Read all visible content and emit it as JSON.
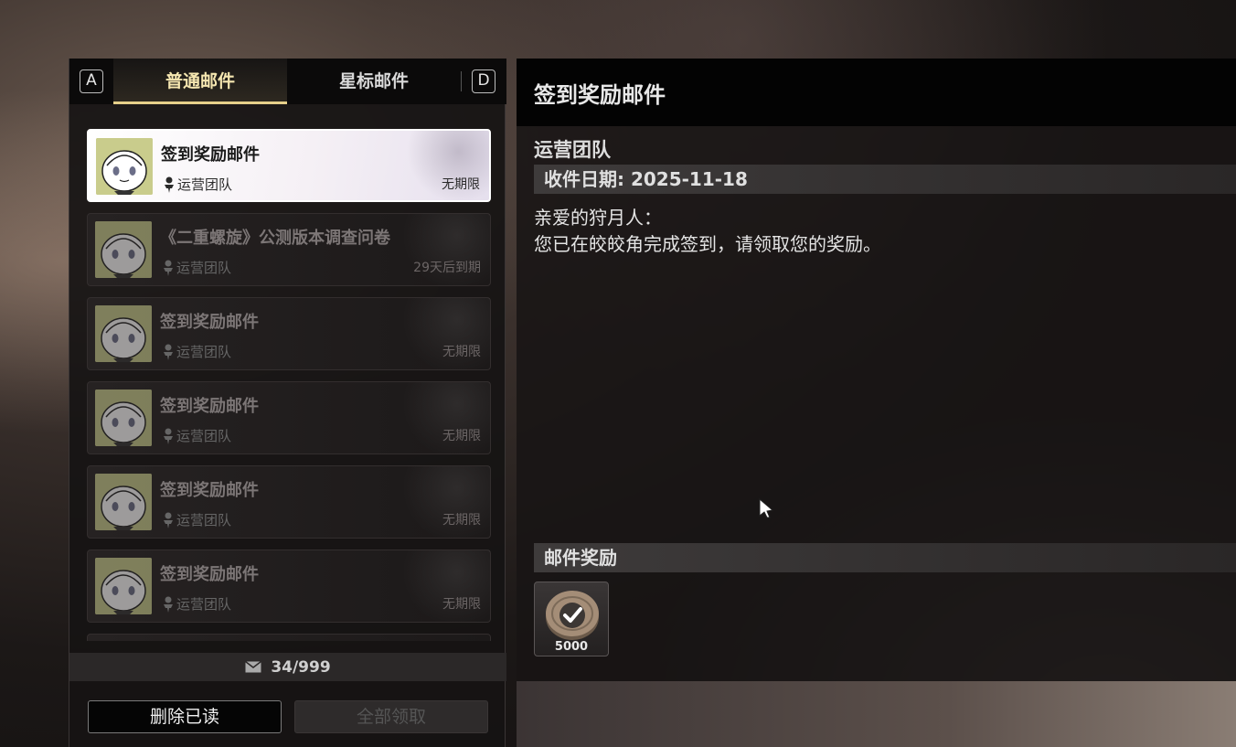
{
  "tabs": {
    "left_key": "A",
    "normal": "普通邮件",
    "starred": "星标邮件",
    "right_key": "D"
  },
  "mail_list": [
    {
      "title": "签到奖励邮件",
      "sender": "运营团队",
      "expiry": "无期限",
      "selected": true
    },
    {
      "title": "《二重螺旋》公测版本调查问卷",
      "sender": "运营团队",
      "expiry": "29天后到期",
      "selected": false
    },
    {
      "title": "签到奖励邮件",
      "sender": "运营团队",
      "expiry": "无期限",
      "selected": false
    },
    {
      "title": "签到奖励邮件",
      "sender": "运营团队",
      "expiry": "无期限",
      "selected": false
    },
    {
      "title": "签到奖励邮件",
      "sender": "运营团队",
      "expiry": "无期限",
      "selected": false
    },
    {
      "title": "签到奖励邮件",
      "sender": "运营团队",
      "expiry": "无期限",
      "selected": false
    }
  ],
  "mail_count": "34/999",
  "buttons": {
    "delete_read": "删除已读",
    "claim_all": "全部领取"
  },
  "detail": {
    "title": "签到奖励邮件",
    "sender": "运营团队",
    "date": "收件日期: 2025-11-18",
    "greeting": "亲爱的狩月人：",
    "body": "您已在皎皎角完成签到，请领取您的奖励。",
    "rewards_label": "邮件奖励",
    "rewards": [
      {
        "icon": "coin-icon",
        "quantity": "5000",
        "claimed": true
      }
    ]
  },
  "colors": {
    "accent_tab": "#e6d08a",
    "selected_item_bg": "#ffffff",
    "panel_bg": "#161414"
  }
}
